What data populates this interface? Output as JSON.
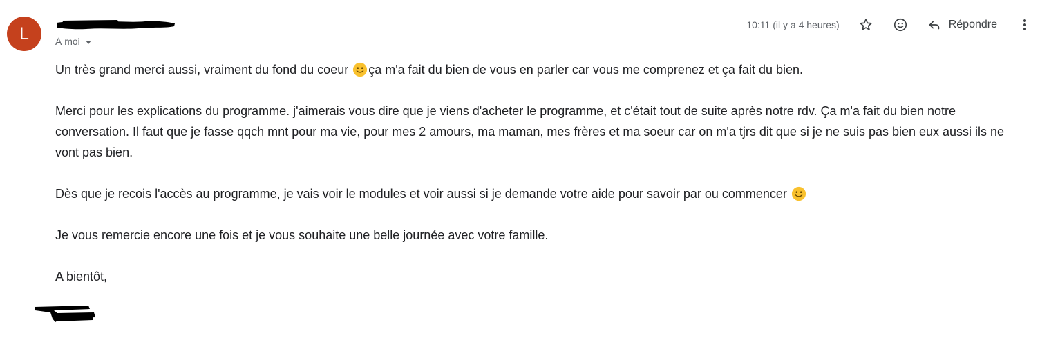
{
  "sender": {
    "avatar_letter": "L",
    "avatar_color": "#c5411d",
    "recipient_label": "À moi"
  },
  "header": {
    "timestamp": "10:11 (il y a 4 heures)",
    "reply_label": "Répondre"
  },
  "icons": {
    "star": "star-outline-icon",
    "emoji": "emoji-reaction-icon",
    "reply": "reply-arrow-icon",
    "more": "more-vertical-icon"
  },
  "message": {
    "p1_before": "Un très grand merci aussi, vraiment du fond du coeur ",
    "p1_after": "ça m'a fait du bien de vous en parler car vous me comprenez et ça fait du bien.",
    "p2": "Merci pour les explications du programme. j'aimerais vous dire que je viens d'acheter le programme, et c'était tout de suite après notre rdv. Ça m'a fait du bien notre conversation. Il faut que je fasse qqch mnt pour ma vie, pour mes 2 amours, ma maman, mes frères et ma soeur car on m'a tjrs dit que si je ne suis pas bien eux aussi ils ne vont pas bien.",
    "p3": "Dès que je recois l'accès au programme, je vais voir le modules et voir aussi si je demande votre aide pour savoir par ou commencer ",
    "p4": "Je vous remercie encore une fois et je vous souhaite une belle journée avec votre famille.",
    "p5": "A bientôt,"
  },
  "colors": {
    "accent_text": "#5f6368",
    "body_text": "#202124",
    "emoji_yellow": "#f9c12e"
  }
}
